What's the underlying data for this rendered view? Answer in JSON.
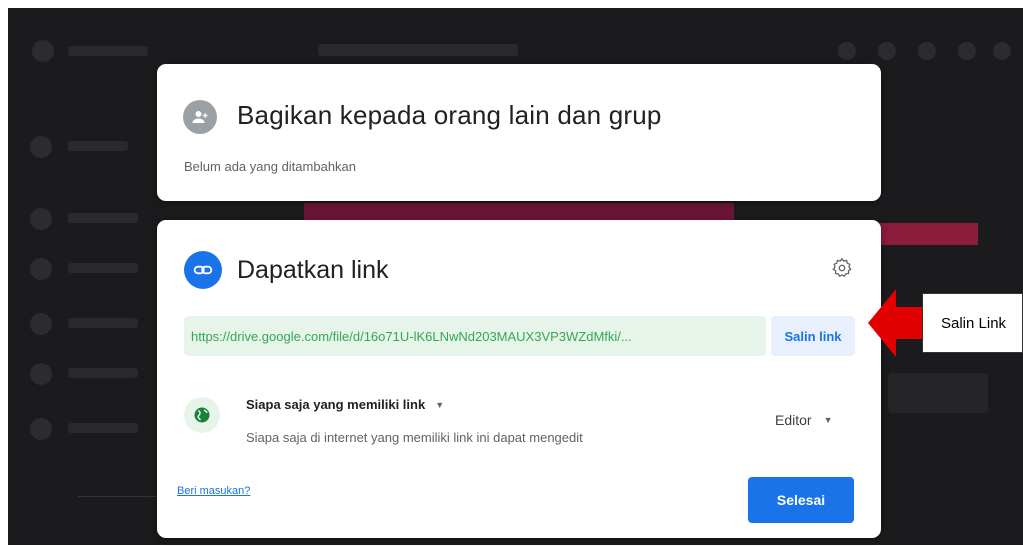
{
  "share_dialog": {
    "title": "Bagikan kepada orang lain dan grup",
    "subtitle": "Belum ada yang ditambahkan",
    "icon": "add-person-icon"
  },
  "link_dialog": {
    "title": "Dapatkan link",
    "icon": "link-icon",
    "settings_icon": "gear-icon",
    "url": "https://drive.google.com/file/d/16o71U-lK6LNwNd203MAUX3VP3WZdMfki/...",
    "copy_label": "Salin link",
    "access": {
      "icon": "globe-icon",
      "title": "Siapa saja yang memiliki link",
      "description": "Siapa saja di internet yang memiliki link ini dapat mengedit",
      "role": "Editor"
    },
    "feedback_label": "Beri masukan?",
    "done_label": "Selesai"
  },
  "annotation": {
    "label": "Salin Link",
    "arrow_color": "#e00000"
  },
  "colors": {
    "accent_blue": "#1a73e8",
    "url_green": "#34a853",
    "backdrop": "#1b1b1d"
  }
}
